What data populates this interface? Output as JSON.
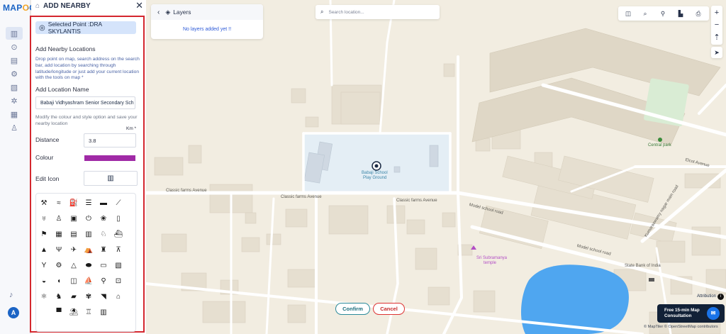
{
  "app": {
    "logo_main": "MAP",
    "logo_accent": "O",
    "logo_end": "G"
  },
  "rail": {
    "icons": [
      "map-icon",
      "pin-icon",
      "document-icon",
      "gear-icon",
      "data-icon",
      "settings-icon",
      "report-icon",
      "people-icon"
    ],
    "notification_icon": "bell-icon",
    "avatar_initial": "A"
  },
  "panel": {
    "title": "ADD NEARBY",
    "selected_point": "Selected Point :DRA SKYLANTIS",
    "section_title": "Add Nearby Locations",
    "instructions": "Drop point on map, search address on the search bar, add location by searching through latitude/longitude or just add your current location with the tools on map *",
    "location_name_label": "Add Location Name",
    "location_name_value": "Babaji Vidhyashram Senior Secondary Sch",
    "style_note": "Modify the colour and style option and save your nearby location",
    "unit": "Km *",
    "distance_label": "Distance",
    "distance_value": "3.8",
    "colour_label": "Colour",
    "colour_value": "#a02aa6",
    "edit_icon_label": "Edit Icon",
    "edit_icon_current": "building-icon"
  },
  "icon_grid": [
    [
      "dumbbell-icon",
      "swimmer-icon",
      "fuel-icon",
      "burger-icon",
      "bus-icon",
      "surfboard-icon"
    ],
    [
      "wine-icon",
      "tooth-icon",
      "train-icon",
      "plug-icon",
      "paw-icon",
      "bottle-icon"
    ],
    [
      "hiker-icon",
      "cinema-icon",
      "hotel-icon",
      "metro-icon",
      "camel-icon",
      "ship-icon"
    ],
    [
      "mountain-icon",
      "dining-icon",
      "plane-icon",
      "tent-icon",
      "police-icon",
      "graduation-icon"
    ],
    [
      "cocktail-icon",
      "atv-icon",
      "tent2-icon",
      "pill-icon",
      "bus2-icon",
      "book-icon"
    ],
    [
      "bowl-icon",
      "car-icon",
      "cinema2-icon",
      "boat-icon",
      "bike-icon",
      "trolley-icon"
    ],
    [
      "tractor-icon",
      "horse-icon",
      "truck-icon",
      "gym-icon",
      "hairdryer-icon",
      "bank-icon"
    ],
    [
      "parking-icon",
      "beach-icon",
      "castle-icon",
      "building-icon"
    ]
  ],
  "icon_glyphs": {
    "dumbbell-icon": "⚒",
    "swimmer-icon": "≈",
    "fuel-icon": "⛽",
    "burger-icon": "☰",
    "bus-icon": "▬",
    "surfboard-icon": "⟋",
    "wine-icon": "♅",
    "tooth-icon": "♙",
    "train-icon": "▣",
    "plug-icon": "⏻",
    "paw-icon": "❀",
    "bottle-icon": "▯",
    "hiker-icon": "⚑",
    "cinema-icon": "▦",
    "hotel-icon": "▤",
    "metro-icon": "▥",
    "camel-icon": "♘",
    "ship-icon": "⛴",
    "mountain-icon": "▲",
    "dining-icon": "Ψ",
    "plane-icon": "✈",
    "tent-icon": "⛺",
    "police-icon": "♜",
    "graduation-icon": "⊼",
    "cocktail-icon": "Y",
    "atv-icon": "⚙",
    "tent2-icon": "△",
    "pill-icon": "⬬",
    "bus2-icon": "▭",
    "book-icon": "▧",
    "bowl-icon": "◒",
    "car-icon": "◖",
    "cinema2-icon": "◫",
    "boat-icon": "⛵",
    "bike-icon": "⚲",
    "trolley-icon": "⊡",
    "tractor-icon": "⚛",
    "horse-icon": "♞",
    "truck-icon": "▰",
    "gym-icon": "✾",
    "hairdryer-icon": "◥",
    "bank-icon": "⌂",
    "parking-icon": "▀",
    "beach-icon": "⛱",
    "castle-icon": "♖",
    "building-icon": "▥"
  },
  "layers": {
    "title": "Layers",
    "empty_text": "No layers added yet !!"
  },
  "search": {
    "placeholder": "Search location..."
  },
  "map_toolbar": [
    "layers-icon",
    "search-icon",
    "pin-person-icon",
    "measure-icon",
    "print-icon"
  ],
  "map_labels": {
    "school": "Babaji School",
    "school_sub": "Play Ground",
    "road1": "Classic farms Avenue",
    "road2": "Classic farms Avenue",
    "road3": "Classic farms Avenue",
    "road4": "Model school road",
    "road5": "Model school road",
    "road6": "Kumaraswamy nagar main road",
    "road7": "Elcot Avenue",
    "park": "Central park",
    "temple": "Sri Subramanya",
    "temple_sub": "temple",
    "bank": "State Bank of India"
  },
  "buttons": {
    "confirm": "Confirm",
    "cancel": "Cancel"
  },
  "consult": {
    "line1": "Free 15-min Map",
    "line2": "Consultation"
  },
  "attribution": {
    "label": "Attribution",
    "copyright": "© MapTiler © OpenStreetMap contributors"
  },
  "colors": {
    "accent": "#1b64c5",
    "highlight_border": "#d4272e",
    "water": "#4fa6f0",
    "school_area": "#e4eef5",
    "park": "#d9ecd4"
  }
}
